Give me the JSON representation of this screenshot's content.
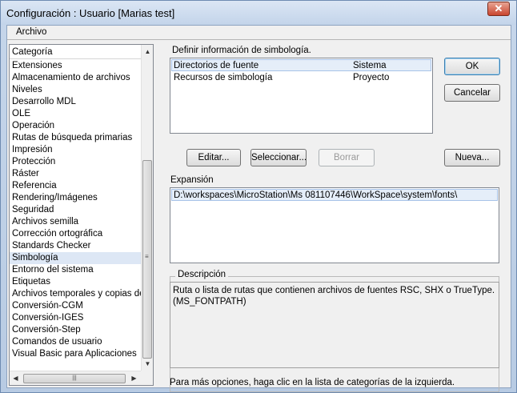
{
  "window": {
    "title": "Configuración : Usuario [Marias test]"
  },
  "menu": {
    "archivo": "Archivo"
  },
  "categories": {
    "header": "Categoría",
    "items": [
      "Extensiones",
      "Almacenamiento de archivos",
      "Niveles",
      "Desarrollo MDL",
      "OLE",
      "Operación",
      "Rutas de búsqueda primarias",
      "Impresión",
      "Protección",
      "Ráster",
      "Referencia",
      "Rendering/Imágenes",
      "Seguridad",
      "Archivos semilla",
      "Corrección ortográfica",
      "Standards Checker",
      "Simbología",
      "Entorno del sistema",
      "Etiquetas",
      "Archivos temporales y copias de s",
      "Conversión-CGM",
      "Conversión-IGES",
      "Conversión-Step",
      "Comandos de usuario",
      "Visual Basic para Aplicaciones"
    ],
    "selected": "Simbología"
  },
  "main": {
    "define_label": "Definir información de simbología.",
    "definitions": [
      {
        "name": "Directorios de fuente",
        "level": "Sistema"
      },
      {
        "name": "Recursos de simbología",
        "level": "Proyecto"
      }
    ],
    "expansion_label": "Expansión",
    "expansion_value": "D:\\workspaces\\MicroStation\\Ms 081107446\\WorkSpace\\system\\fonts\\",
    "description_label": "Descripción",
    "description_line1": "Ruta o lista de rutas que contienen archivos de fuentes RSC, SHX o TrueType.",
    "description_line2": "(MS_FONTPATH)",
    "footer": "Para más opciones, haga clic en la lista de categorías de la izquierda."
  },
  "buttons": {
    "ok": "OK",
    "cancel": "Cancelar",
    "edit": "Editar...",
    "select": "Seleccionar...",
    "delete": "Borrar",
    "new": "Nueva..."
  }
}
